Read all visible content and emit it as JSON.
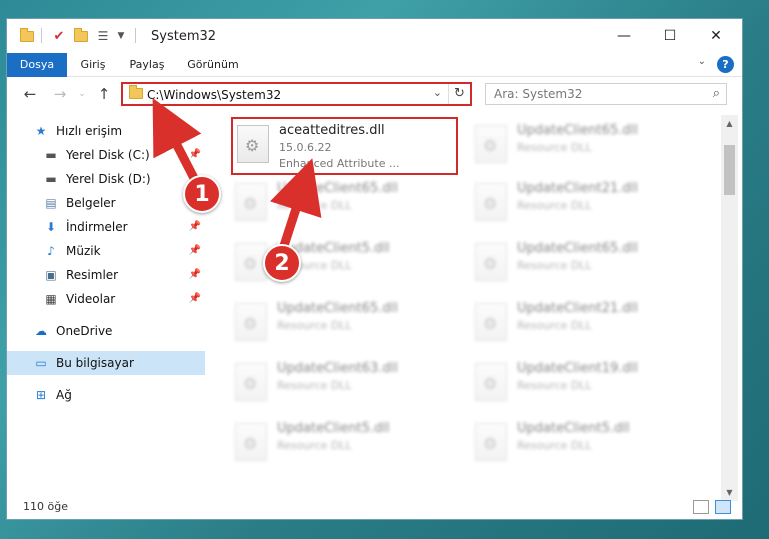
{
  "window": {
    "title": "System32",
    "controls": {
      "minimize": "—",
      "maximize": "☐",
      "close": "✕"
    }
  },
  "ribbon": {
    "tabs": [
      {
        "label": "Dosya",
        "active": true
      },
      {
        "label": "Giriş"
      },
      {
        "label": "Paylaş"
      },
      {
        "label": "Görünüm"
      }
    ],
    "help": "?"
  },
  "address": {
    "path": "C:\\Windows\\System32"
  },
  "search": {
    "placeholder": "Ara: System32"
  },
  "sidebar": {
    "items": [
      {
        "label": "Hızlı erişim",
        "icon": "star-icon",
        "pinned": false
      },
      {
        "label": "Yerel Disk (C:)",
        "icon": "drive-icon",
        "pinned": true
      },
      {
        "label": "Yerel Disk (D:)",
        "icon": "drive-icon",
        "pinned": false
      },
      {
        "label": "Belgeler",
        "icon": "document-icon",
        "pinned": true
      },
      {
        "label": "İndirmeler",
        "icon": "download-icon",
        "pinned": true
      },
      {
        "label": "Müzik",
        "icon": "music-icon",
        "pinned": true
      },
      {
        "label": "Resimler",
        "icon": "picture-icon",
        "pinned": true
      },
      {
        "label": "Videolar",
        "icon": "video-icon",
        "pinned": true
      },
      {
        "label": "OneDrive",
        "icon": "cloud-icon",
        "pinned": false
      },
      {
        "label": "Bu bilgisayar",
        "icon": "computer-icon",
        "pinned": false,
        "selected": true
      },
      {
        "label": "Ağ",
        "icon": "network-icon",
        "pinned": false
      }
    ]
  },
  "files": {
    "highlighted": {
      "name": "aceatteditres.dll",
      "version": "15.0.6.22",
      "description": "Enhanced Attribute ..."
    },
    "others": [
      {
        "name": "UpdateClient65.dll",
        "type": "Resource DLL"
      },
      {
        "name": "UpdateClient65.dll",
        "type": "Resource DLL"
      },
      {
        "name": "UpdateClient21.dll",
        "type": "Resource DLL"
      },
      {
        "name": "UpdateClient5.dll",
        "type": "Resource DLL"
      },
      {
        "name": "UpdateClient65.dll",
        "type": "Resource DLL"
      },
      {
        "name": "UpdateClient65.dll",
        "type": "Resource DLL"
      },
      {
        "name": "UpdateClient21.dll",
        "type": "Resource DLL"
      },
      {
        "name": "UpdateClient63.dll",
        "type": "Resource DLL"
      },
      {
        "name": "UpdateClient19.dll",
        "type": "Resource DLL"
      },
      {
        "name": "UpdateClient5.dll",
        "type": "Resource DLL"
      },
      {
        "name": "UpdateClient5.dll",
        "type": "Resource DLL"
      }
    ]
  },
  "status": {
    "count": "110 öğe"
  },
  "callouts": {
    "step1": "1",
    "step2": "2"
  },
  "colors": {
    "accent": "#1a6fc4",
    "highlight": "#d22a2a",
    "selection": "#cce4f7"
  }
}
